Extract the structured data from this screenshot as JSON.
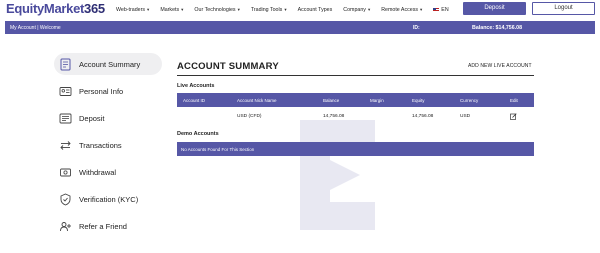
{
  "header": {
    "logo_part1": "EquityMarket",
    "logo_part2": "365",
    "nav": [
      {
        "label": "Web-traders",
        "chevron": true
      },
      {
        "label": "Markets",
        "chevron": true
      },
      {
        "label": "Our Technologies",
        "chevron": true
      },
      {
        "label": "Trading Tools",
        "chevron": true
      },
      {
        "label": "Account Types",
        "chevron": false
      },
      {
        "label": "Company",
        "chevron": true
      },
      {
        "label": "Remote Access",
        "chevron": true
      }
    ],
    "language": "EN",
    "deposit_label": "Deposit",
    "logout_label": "Logout"
  },
  "strip": {
    "left_text": "My Account | Welcome",
    "id_label": "ID:",
    "balance_text": "Balance: $14,756.08"
  },
  "sidebar": {
    "items": [
      {
        "label": "Account Summary",
        "icon": "account-summary-icon"
      },
      {
        "label": "Personal Info",
        "icon": "personal-info-icon"
      },
      {
        "label": "Deposit",
        "icon": "deposit-icon"
      },
      {
        "label": "Transactions",
        "icon": "transactions-icon"
      },
      {
        "label": "Withdrawal",
        "icon": "withdrawal-icon"
      },
      {
        "label": "Verification (KYC)",
        "icon": "verification-icon"
      },
      {
        "label": "Refer a Friend",
        "icon": "refer-friend-icon"
      }
    ],
    "active_index": 0
  },
  "main": {
    "title": "ACCOUNT SUMMARY",
    "add_live": "ADD NEW LIVE ACCOUNT",
    "live_label": "Live Accounts",
    "columns": [
      "Account ID",
      "Account Nick Name",
      "Balance",
      "Margin",
      "Equity",
      "Currency",
      "Edit"
    ],
    "rows": [
      {
        "account_id": "",
        "nickname": "USD (CFD)",
        "balance": "14,756.08",
        "margin": "",
        "equity": "14,756.08",
        "currency": "USD"
      }
    ],
    "demo_label": "Demo Accounts",
    "demo_empty": "No Accounts Found For This Section"
  },
  "colors": {
    "accent": "#5657a6",
    "sidebar_active_bg": "#efeff1",
    "watermark": "#e8e8f2"
  }
}
